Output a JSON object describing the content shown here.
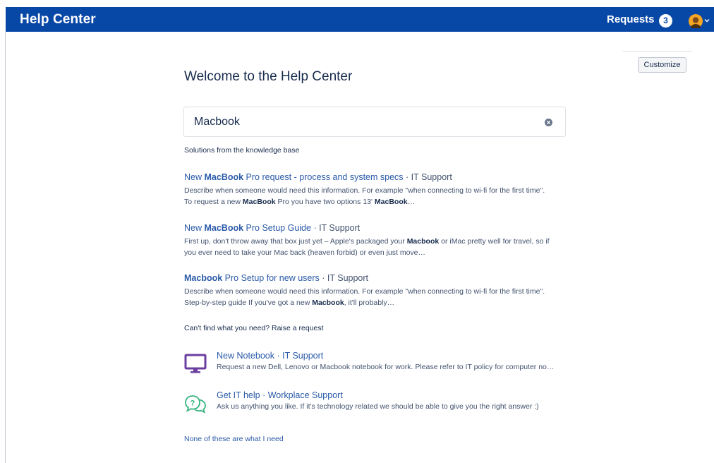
{
  "header": {
    "brand": "Help Center",
    "requests_label": "Requests",
    "requests_count": "3"
  },
  "customize_label": "Customize",
  "page_title": "Welcome to the Help Center",
  "search": {
    "value": "Macbook",
    "placeholder": ""
  },
  "kb_section_label": "Solutions from the knowledge base",
  "kb_results": [
    {
      "title_parts": [
        [
          "New ",
          false
        ],
        [
          "MacBook",
          true
        ],
        [
          " Pro request - process and system specs",
          false
        ]
      ],
      "portal": "IT Support",
      "desc_parts": [
        [
          "Describe when someone would need this information. For example \"when connecting to wi-fi for the first time\". To request a new ",
          false
        ],
        [
          "MacBook",
          true
        ],
        [
          " Pro you have two options 13' ",
          false
        ],
        [
          "MacBook",
          true
        ],
        [
          "…",
          false
        ]
      ]
    },
    {
      "title_parts": [
        [
          "New ",
          false
        ],
        [
          "MacBook",
          true
        ],
        [
          " Pro Setup Guide",
          false
        ]
      ],
      "portal": "IT Support",
      "desc_parts": [
        [
          "First up, don't throw away that box just yet – Apple's packaged your ",
          false
        ],
        [
          "Macbook",
          true
        ],
        [
          " or iMac pretty well for travel, so if you ever need to take your Mac back (heaven forbid) or even just move…",
          false
        ]
      ]
    },
    {
      "title_parts": [
        [
          "Macbook",
          true
        ],
        [
          " Pro Setup for new users",
          false
        ]
      ],
      "portal": "IT Support",
      "desc_parts": [
        [
          "Describe when someone would need this information. For example \"when connecting to wi-fi for the first time\". Step-by-step guide If you've got a new ",
          false
        ],
        [
          "Macbook",
          true
        ],
        [
          ", it'll probably…",
          false
        ]
      ]
    }
  ],
  "raise_section_label": "Can't find what you need? Raise a request",
  "request_types": [
    {
      "icon": "monitor-icon",
      "title": "New Notebook",
      "portal": "IT Support",
      "desc": "Request a new Dell, Lenovo or Macbook notebook for work. Please refer to IT policy for computer no…",
      "color": "#6b3fa0"
    },
    {
      "icon": "question-bubble-icon",
      "title": "Get IT help",
      "portal": "Workplace Support",
      "desc": "Ask us anything you like. If it's technology related we should be able to give you the right answer :)",
      "color": "#36b37e"
    }
  ],
  "none_link": "None of these are what I need",
  "separator": " · ",
  "colors": {
    "header_bg": "#0747a6",
    "link": "#2a5aa8"
  }
}
